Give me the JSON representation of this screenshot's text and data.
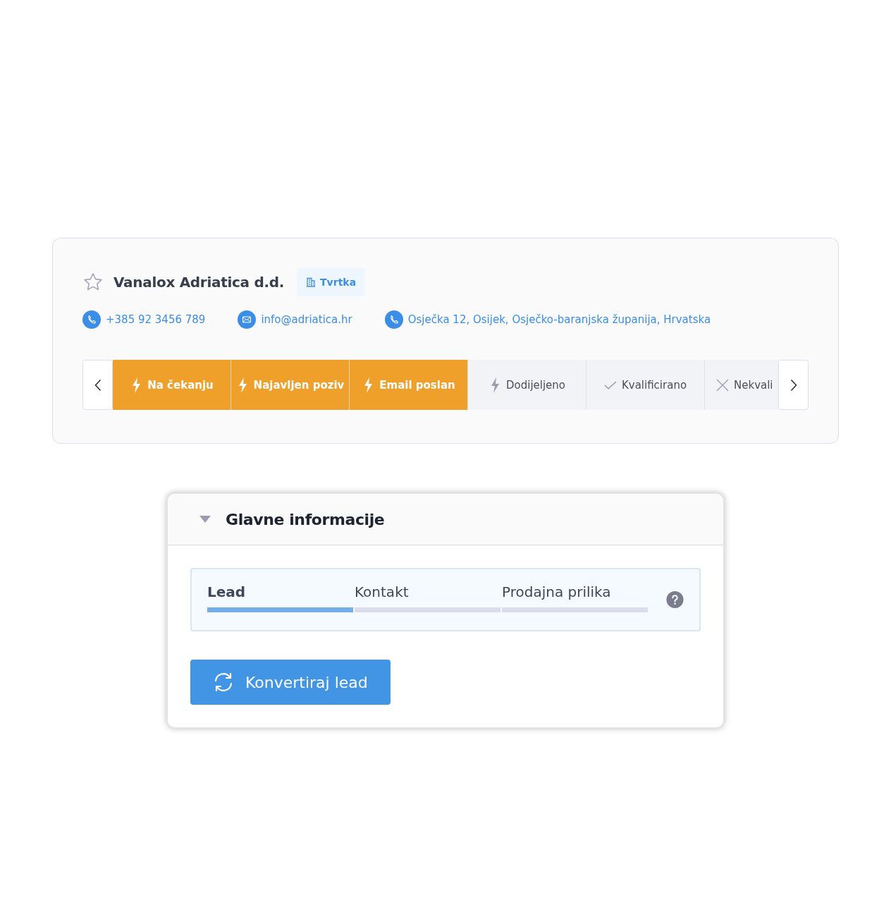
{
  "header": {
    "favorite": false,
    "name": "Vanalox Adriatica d.d.",
    "badge": "Tvrtka"
  },
  "contacts": [
    {
      "kind": "phone",
      "text": "+385 92 3456 789"
    },
    {
      "kind": "mail",
      "text": "info@adriatica.hr"
    },
    {
      "kind": "phone",
      "text": "Osječka 12, Osijek, Osječko-baranjska županija, Hrvatska"
    }
  ],
  "stages": [
    {
      "kind": "bolt",
      "label": "Na čekanju",
      "active": true
    },
    {
      "kind": "bolt",
      "label": "Najavljen poziv",
      "active": true
    },
    {
      "kind": "bolt",
      "label": "Email poslan",
      "active": true
    },
    {
      "kind": "bolt",
      "label": "Dodijeljeno",
      "active": false
    },
    {
      "kind": "check",
      "label": "Kvalificirano",
      "active": false
    },
    {
      "kind": "cross",
      "label": "Nekvali",
      "active": false
    }
  ],
  "section": {
    "title": "Glavne informacije",
    "expanded": true,
    "steps": [
      {
        "label": "Lead",
        "selected": true
      },
      {
        "label": "Kontakt",
        "selected": false
      },
      {
        "label": "Prodajna prilika",
        "selected": false
      }
    ],
    "button": "Konvertiraj lead"
  }
}
